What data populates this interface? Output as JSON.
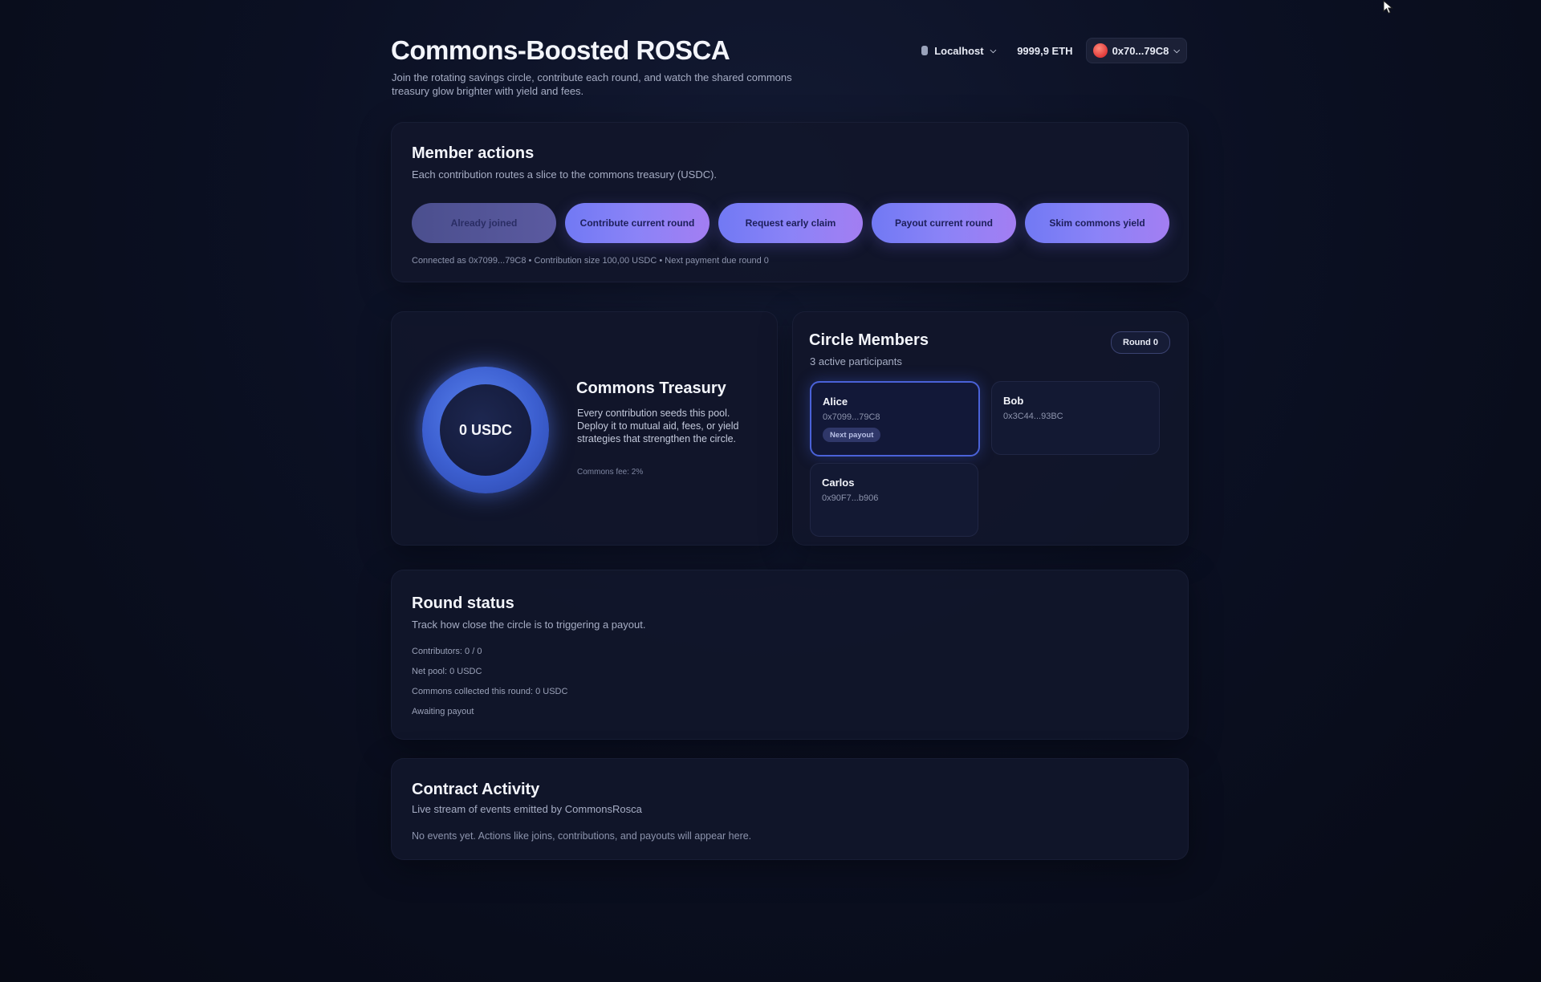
{
  "header": {
    "title": "Commons-Boosted ROSCA",
    "subtitle": "Join the rotating savings circle, contribute each round, and watch the shared commons treasury glow brighter with yield and fees.",
    "network": "Localhost",
    "balance": "9999,9 ETH",
    "account": "0x70...79C8"
  },
  "member_actions": {
    "title": "Member actions",
    "subtitle": "Each contribution routes a slice to the commons treasury (USDC).",
    "buttons": [
      {
        "label": "Already joined",
        "disabled": true
      },
      {
        "label": "Contribute current round",
        "disabled": false
      },
      {
        "label": "Request early claim",
        "disabled": false
      },
      {
        "label": "Payout current round",
        "disabled": false
      },
      {
        "label": "Skim commons yield",
        "disabled": false
      }
    ],
    "connection_info": "Connected as 0x7099...79C8 • Contribution size 100,00 USDC • Next payment due round 0"
  },
  "treasury": {
    "amount": "0 USDC",
    "title": "Commons Treasury",
    "description": "Every contribution seeds this pool. Deploy it to mutual aid, fees, or yield strategies that strengthen the circle.",
    "fee": "Commons fee: 2%"
  },
  "members": {
    "title": "Circle Members",
    "subtitle": "3 active participants",
    "round_badge": "Round 0",
    "list": [
      {
        "name": "Alice",
        "address": "0x7099...79C8",
        "badge": "Next payout"
      },
      {
        "name": "Bob",
        "address": "0x3C44...93BC"
      },
      {
        "name": "Carlos",
        "address": "0x90F7...b906"
      }
    ]
  },
  "round_status": {
    "title": "Round status",
    "subtitle": "Track how close the circle is to triggering a payout.",
    "lines": [
      "Contributors: 0 / 0",
      "Net pool: 0 USDC",
      "Commons collected this round: 0 USDC",
      "Awaiting payout"
    ]
  },
  "activity": {
    "title": "Contract Activity",
    "subtitle": "Live stream of events emitted by CommonsRosca",
    "empty": "No events yet. Actions like joins, contributions, and payouts will appear here."
  }
}
